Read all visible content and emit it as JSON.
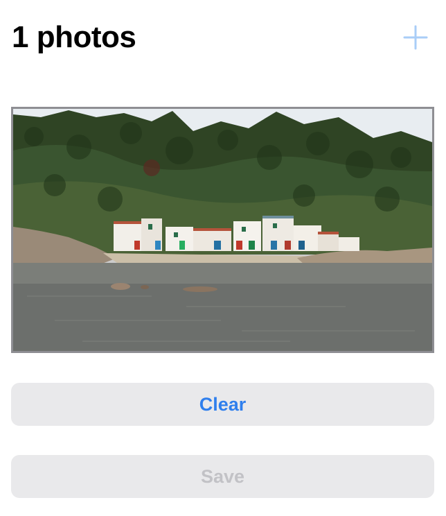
{
  "header": {
    "title": "1 photos",
    "add_icon": "plus-icon",
    "accent_color": "#a9cdf7"
  },
  "photo": {
    "icon": "photo-thumbnail"
  },
  "actions": {
    "clear_label": "Clear",
    "save_label": "Save",
    "clear_color": "#2f7fed",
    "save_color_disabled": "#c2c2c6",
    "button_bg": "#e9e9eb"
  }
}
